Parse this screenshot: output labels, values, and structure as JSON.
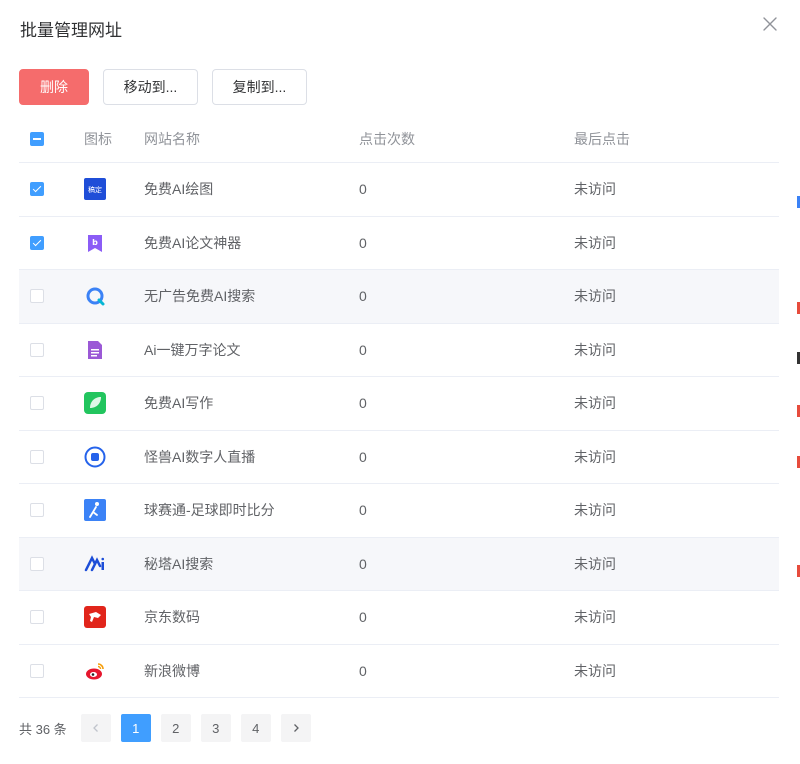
{
  "dialog": {
    "title": "批量管理网址"
  },
  "toolbar": {
    "delete_label": "删除",
    "move_label": "移动到...",
    "copy_label": "复制到..."
  },
  "table": {
    "headers": {
      "icon": "图标",
      "name": "网站名称",
      "clicks": "点击次数",
      "last": "最后点击"
    },
    "rows": [
      {
        "icon": "gaoding-logo-icon",
        "name": "免费AI绘图",
        "clicks": "0",
        "last": "未访问",
        "checked": true
      },
      {
        "icon": "bookmark-b-icon",
        "name": "免费AI论文神器",
        "clicks": "0",
        "last": "未访问",
        "checked": true
      },
      {
        "icon": "search-refresh-icon",
        "name": "无广告免费AI搜索",
        "clicks": "0",
        "last": "未访问",
        "checked": false
      },
      {
        "icon": "document-icon",
        "name": "Ai一键万字论文",
        "clicks": "0",
        "last": "未访问",
        "checked": false
      },
      {
        "icon": "leaf-icon",
        "name": "免费AI写作",
        "clicks": "0",
        "last": "未访问",
        "checked": false
      },
      {
        "icon": "robot-circle-icon",
        "name": "怪兽AI数字人直播",
        "clicks": "0",
        "last": "未访问",
        "checked": false
      },
      {
        "icon": "soccer-player-icon",
        "name": "球赛通-足球即时比分",
        "clicks": "0",
        "last": "未访问",
        "checked": false
      },
      {
        "icon": "metaso-logo-icon",
        "name": "秘塔AI搜索",
        "clicks": "0",
        "last": "未访问",
        "checked": false
      },
      {
        "icon": "jd-dog-icon",
        "name": "京东数码",
        "clicks": "0",
        "last": "未访问",
        "checked": false
      },
      {
        "icon": "weibo-icon",
        "name": "新浪微博",
        "clicks": "0",
        "last": "未访问",
        "checked": false
      }
    ]
  },
  "pagination": {
    "total": "共 36 条",
    "pages": [
      "1",
      "2",
      "3",
      "4"
    ],
    "current": "1"
  },
  "colors": {
    "primary": "#409eff",
    "danger": "#f56c6c",
    "stripe": "#f6f7fa"
  }
}
